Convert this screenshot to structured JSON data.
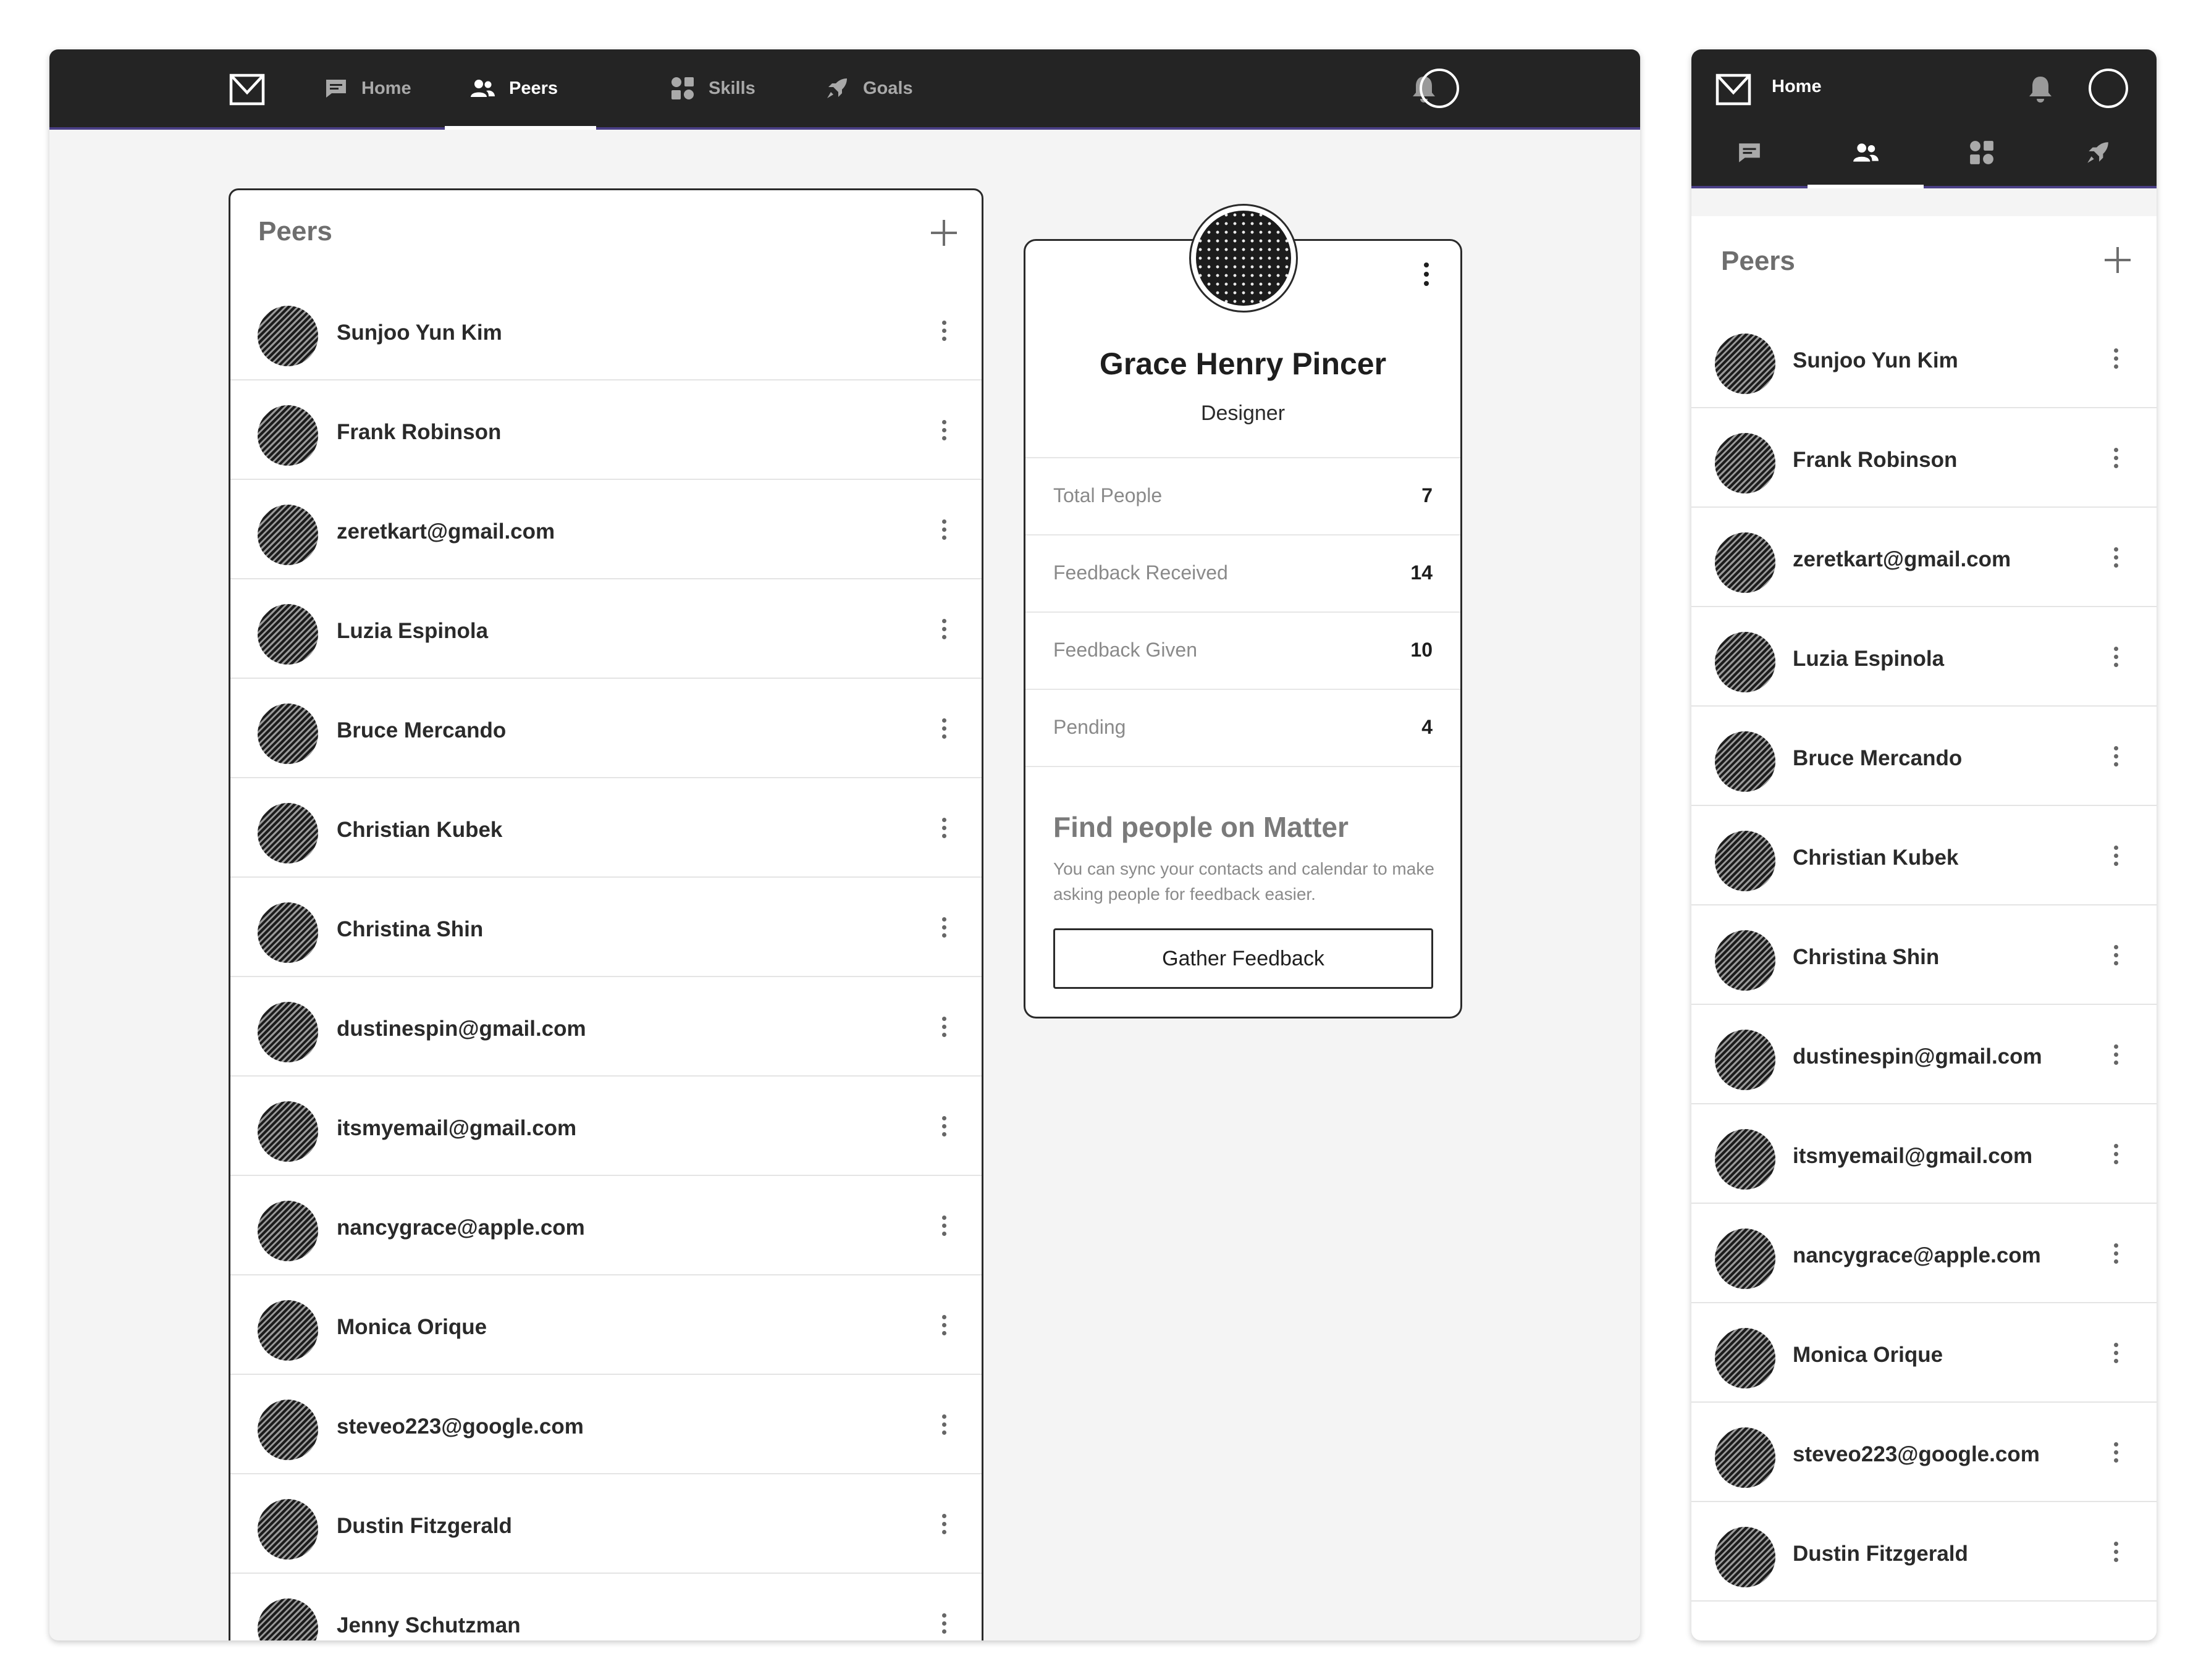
{
  "nav": {
    "items": [
      {
        "label": "Home",
        "icon": "chat-icon"
      },
      {
        "label": "Peers",
        "icon": "people-icon"
      },
      {
        "label": "Skills",
        "icon": "skills-icon"
      },
      {
        "label": "Goals",
        "icon": "rocket-icon"
      }
    ],
    "active": "Peers"
  },
  "peers": {
    "title": "Peers",
    "desktop_list": [
      "Sunjoo Yun Kim",
      "Frank Robinson",
      "zeretkart@gmail.com",
      "Luzia Espinola",
      "Bruce Mercando",
      "Christian Kubek",
      "Christina Shin",
      "dustinespin@gmail.com",
      "itsmyemail@gmail.com",
      "nancygrace@apple.com",
      "Monica Orique",
      "steveo223@google.com",
      "Dustin Fitzgerald",
      "Jenny Schutzman"
    ],
    "mobile_list": [
      "Sunjoo Yun Kim",
      "Frank Robinson",
      "zeretkart@gmail.com",
      "Luzia Espinola",
      "Bruce Mercando",
      "Christian Kubek",
      "Christina Shin",
      "dustinespin@gmail.com",
      "itsmyemail@gmail.com",
      "nancygrace@apple.com",
      "Monica Orique",
      "steveo223@google.com",
      "Dustin Fitzgerald"
    ]
  },
  "profile": {
    "name": "Grace Henry Pincer",
    "role": "Designer",
    "stats": [
      {
        "label": "Total People",
        "value": "7"
      },
      {
        "label": "Feedback Received",
        "value": "14"
      },
      {
        "label": "Feedback Given",
        "value": "10"
      },
      {
        "label": "Pending",
        "value": "4"
      }
    ],
    "find_title": "Find people on Matter",
    "find_description": "You can sync your contacts and calendar to make asking people for feedback easier.",
    "button_label": "Gather Feedback"
  },
  "mobile": {
    "title": "Home"
  },
  "colors": {
    "topbar": "#242424",
    "accent_line": "#4a3f86",
    "background": "#f4f4f4"
  }
}
